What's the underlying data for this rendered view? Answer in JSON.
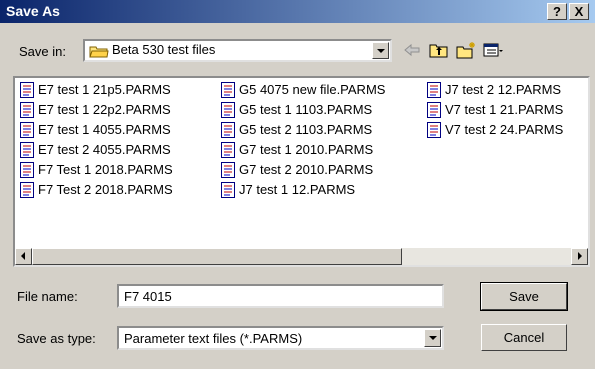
{
  "window": {
    "title": "Save As"
  },
  "titlebar_buttons": {
    "help": "?",
    "close": "X"
  },
  "save_in": {
    "label": "Save in:",
    "value": "Beta 530 test files"
  },
  "toolbar_icons": [
    "back-icon",
    "up-folder-icon",
    "new-folder-icon",
    "view-menu-icon"
  ],
  "files": {
    "columns": [
      [
        "E7 test 1 21p5.PARMS",
        "E7 test 1 22p2.PARMS",
        "E7 test 1 4055.PARMS",
        "E7 test 2 4055.PARMS",
        "F7 Test 1 2018.PARMS",
        "F7 Test 2 2018.PARMS"
      ],
      [
        "G5 4075 new file.PARMS",
        "G5 test 1 1103.PARMS",
        "G5 test 2 1103.PARMS",
        "G7 test 1 2010.PARMS",
        "G7 test 2 2010.PARMS",
        "J7 test 1 12.PARMS"
      ],
      [
        "J7 test 2 12.PARMS",
        "V7 test 1 21.PARMS",
        "V7 test 2 24.PARMS"
      ]
    ]
  },
  "file_name": {
    "label": "File name:",
    "value": "F7 4015"
  },
  "save_as_type": {
    "label": "Save as type:",
    "value": "Parameter text files (*.PARMS)"
  },
  "buttons": {
    "save": "Save",
    "cancel": "Cancel"
  }
}
